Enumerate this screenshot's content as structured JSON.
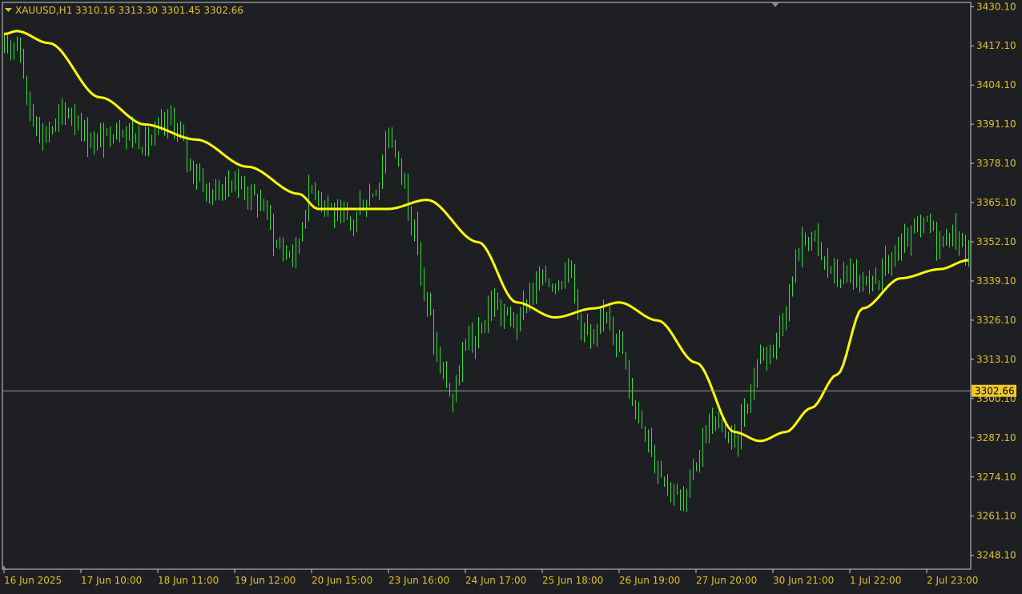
{
  "header": {
    "symbol": "XAUUSD,H1",
    "ohlc": "3310.16 3313.30 3301.45 3302.66"
  },
  "colors": {
    "background": "#1e1f23",
    "candle": "#33dd33",
    "ma_line": "#ffff00",
    "axis_text": "#e0c020",
    "price_tag_bg": "#f0c828",
    "price_line": "#9a9a9a",
    "border": "#c8c8c8"
  },
  "chart_data": {
    "type": "line",
    "title": "",
    "xlabel": "",
    "ylabel": "",
    "ylim": [
      3243.5,
      3431.5
    ],
    "grid": false,
    "y_ticks": [
      "3430.10",
      "3417.10",
      "3404.10",
      "3391.10",
      "3378.10",
      "3365.10",
      "3352.10",
      "3339.10",
      "3326.10",
      "3313.10",
      "3300.10",
      "3287.10",
      "3274.10",
      "3261.10",
      "3248.10"
    ],
    "x_ticks": [
      "16 Jun 2025",
      "17 Jun 10:00",
      "18 Jun 11:00",
      "19 Jun 12:00",
      "20 Jun 15:00",
      "23 Jun 16:00",
      "24 Jun 17:00",
      "25 Jun 18:00",
      "26 Jun 19:00",
      "27 Jun 20:00",
      "30 Jun 21:00",
      "1 Jul 22:00",
      "2 Jul 23:00"
    ],
    "x_tick_index": [
      0,
      24,
      48,
      72,
      96,
      120,
      144,
      168,
      192,
      216,
      240,
      264,
      288
    ],
    "bar_count": 302,
    "current_price": "3302.66",
    "series": [
      {
        "kind": "candles",
        "anchor_bars": [
          0,
          4,
          8,
          12,
          20,
          28,
          36,
          44,
          52,
          60,
          64,
          72,
          80,
          86,
          90,
          96,
          100,
          104,
          108,
          112,
          116,
          120,
          124,
          128,
          132,
          136,
          140,
          144,
          148,
          152,
          156,
          160,
          164,
          168,
          172,
          176,
          180,
          184,
          188,
          192,
          196,
          200,
          204,
          208,
          212,
          216,
          220,
          224,
          228,
          232,
          236,
          240,
          244,
          248,
          252,
          256,
          260,
          264,
          268,
          272,
          276,
          280,
          284,
          288,
          292,
          296,
          301
        ],
        "anchor_close": [
          3415,
          3420,
          3395,
          3388,
          3395,
          3385,
          3390,
          3385,
          3392,
          3375,
          3368,
          3372,
          3365,
          3350,
          3348,
          3370,
          3366,
          3360,
          3358,
          3365,
          3370,
          3388,
          3375,
          3355,
          3330,
          3310,
          3300,
          3318,
          3320,
          3332,
          3328,
          3325,
          3335,
          3340,
          3338,
          3345,
          3325,
          3318,
          3330,
          3318,
          3300,
          3290,
          3278,
          3270,
          3265,
          3280,
          3292,
          3290,
          3285,
          3300,
          3315,
          3318,
          3330,
          3350,
          3355,
          3345,
          3340,
          3342,
          3335,
          3340,
          3345,
          3350,
          3355,
          3358,
          3352,
          3355,
          3348
        ]
      },
      {
        "kind": "moving-average",
        "anchor_bars": [
          0,
          4,
          14,
          30,
          44,
          60,
          76,
          92,
          98,
          110,
          120,
          132,
          148,
          160,
          172,
          184,
          192,
          204,
          216,
          228,
          236,
          244,
          252,
          260,
          268,
          280,
          292,
          301
        ],
        "anchor_values": [
          3421,
          3422,
          3418,
          3400,
          3391,
          3386,
          3377,
          3368,
          3363,
          3363,
          3363,
          3366,
          3352,
          3332,
          3327,
          3330,
          3332,
          3326,
          3312,
          3289,
          3286,
          3289,
          3297,
          3308,
          3330,
          3340,
          3343,
          3346
        ]
      }
    ]
  }
}
